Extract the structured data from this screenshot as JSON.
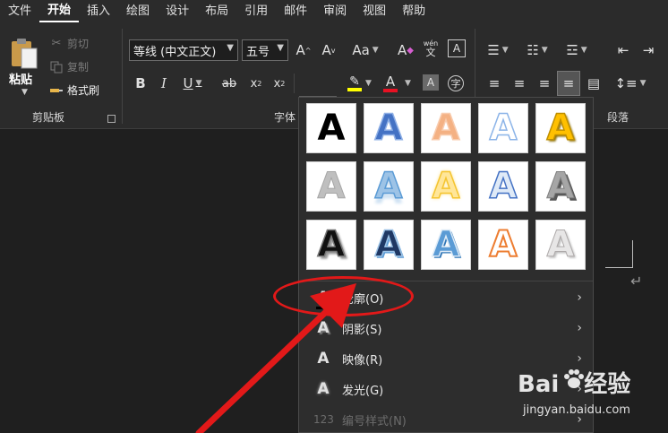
{
  "menubar": {
    "tabs": [
      "文件",
      "开始",
      "插入",
      "绘图",
      "设计",
      "布局",
      "引用",
      "邮件",
      "审阅",
      "视图",
      "帮助"
    ],
    "active": "开始"
  },
  "clipboard": {
    "paste": "粘贴",
    "cut": "剪切",
    "copy": "复制",
    "format_painter": "格式刷",
    "group_label": "剪贴板"
  },
  "font": {
    "font_name": "等线 (中文正文)",
    "font_size": "五号",
    "change_case": "Aa",
    "phonetic_top": "wén",
    "phonetic_bottom": "文",
    "group_label": "字体"
  },
  "paragraph": {
    "group_label": "段落"
  },
  "colors": {
    "highlight": "#ffff00",
    "font_color": "#e81123",
    "annotation": "#e21919"
  },
  "text_effects_menu": {
    "items": [
      {
        "label": "轮廓(O)",
        "icon": "text-outline-icon",
        "enabled": true
      },
      {
        "label": "阴影(S)",
        "icon": "text-shadow-icon",
        "enabled": true
      },
      {
        "label": "映像(R)",
        "icon": "text-reflection-icon",
        "enabled": true
      },
      {
        "label": "发光(G)",
        "icon": "text-glow-icon",
        "enabled": true
      },
      {
        "label": "编号样式(N)",
        "icon": "number-style-icon",
        "enabled": false
      }
    ],
    "number_icon_text": "123"
  },
  "watermark": {
    "logo_left": "Bai",
    "logo_right": "经验",
    "url": "jingyan.baidu.com"
  }
}
